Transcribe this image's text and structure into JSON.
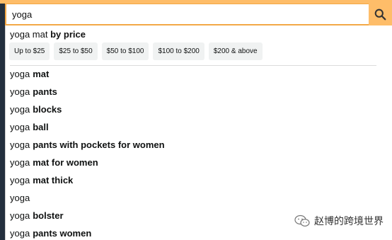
{
  "search": {
    "value": "yoga",
    "button_icon": "search-icon"
  },
  "price_section": {
    "prefix": "yoga mat",
    "bold": "by price",
    "chips": [
      "Up to $25",
      "$25 to $50",
      "$50 to $100",
      "$100 to $200",
      "$200 & above"
    ]
  },
  "suggestions": [
    {
      "prefix": "yoga",
      "bold": "mat"
    },
    {
      "prefix": "yoga",
      "bold": "pants"
    },
    {
      "prefix": "yoga",
      "bold": "blocks"
    },
    {
      "prefix": "yoga",
      "bold": "ball"
    },
    {
      "prefix": "yoga",
      "bold": "pants with pockets for women"
    },
    {
      "prefix": "yoga",
      "bold": "mat for women"
    },
    {
      "prefix": "yoga",
      "bold": "mat thick"
    },
    {
      "prefix": "yoga",
      "bold": ""
    },
    {
      "prefix": "yoga",
      "bold": "bolster"
    },
    {
      "prefix": "yoga",
      "bold": "pants women"
    }
  ],
  "watermark": {
    "text": "赵博的跨境世界",
    "icon": "wechat-icon"
  },
  "colors": {
    "accent": "#febd69",
    "border": "#f3a847",
    "chip_bg": "#f0f2f2",
    "page_dark": "#232f3e"
  }
}
